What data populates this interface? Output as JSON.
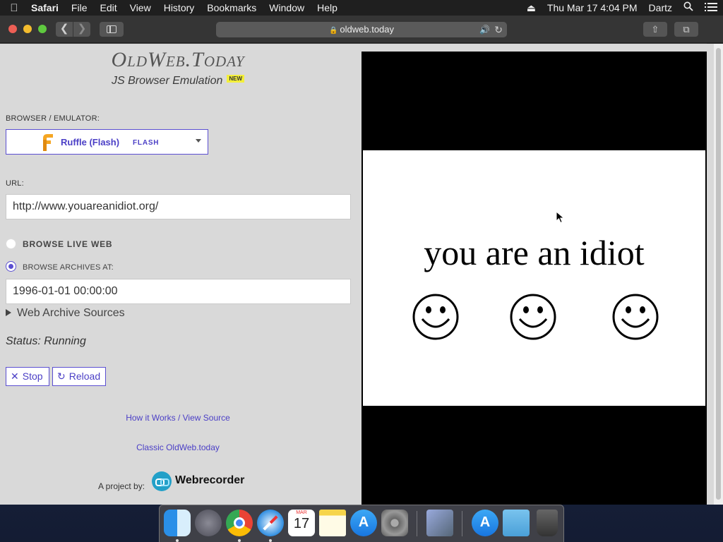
{
  "menubar": {
    "app_name": "Safari",
    "items": [
      "File",
      "Edit",
      "View",
      "History",
      "Bookmarks",
      "Window",
      "Help"
    ],
    "clock": "Thu Mar 17  4:04 PM",
    "user": "Dartz"
  },
  "browser": {
    "address": "oldweb.today"
  },
  "page": {
    "logo": "OldWeb.Today",
    "subtitle": "JS Browser Emulation",
    "new_badge": "NEW",
    "emulator_label": "BROWSER / EMULATOR:",
    "emulator_name": "Ruffle (Flash)",
    "emulator_tag": "FLASH",
    "url_label": "URL:",
    "url_value": "http://www.youareanidiot.org/",
    "browse_live_label": "BROWSE LIVE WEB",
    "browse_archives_label": "BROWSE ARCHIVES AT:",
    "archive_datetime": "1996-01-01 00:00:00",
    "web_archive_sources": "Web Archive Sources",
    "status": "Status: Running",
    "stop_label": "Stop",
    "reload_label": "Reload",
    "how_it_works_link": "How it Works / View Source",
    "classic_link": "Classic OldWeb.today",
    "project_by": "A project by:",
    "webrecorder": "Webrecorder"
  },
  "emulator": {
    "content_text": "you are an idiot"
  },
  "dock": {
    "apps": [
      "finder-icon",
      "launchpad-icon",
      "chrome-icon",
      "safari-icon",
      "calendar-icon",
      "notes-icon",
      "app-store-icon",
      "system-preferences-icon",
      "preview-icon",
      "app-store-downloads-icon",
      "downloads-folder-icon",
      "trash-icon"
    ],
    "calendar_month": "MAR",
    "calendar_day": "17"
  },
  "colors": {
    "accent": "#5b4fd1",
    "page_bg": "#d9d9d9",
    "new_badge": "#f3ef3a"
  }
}
